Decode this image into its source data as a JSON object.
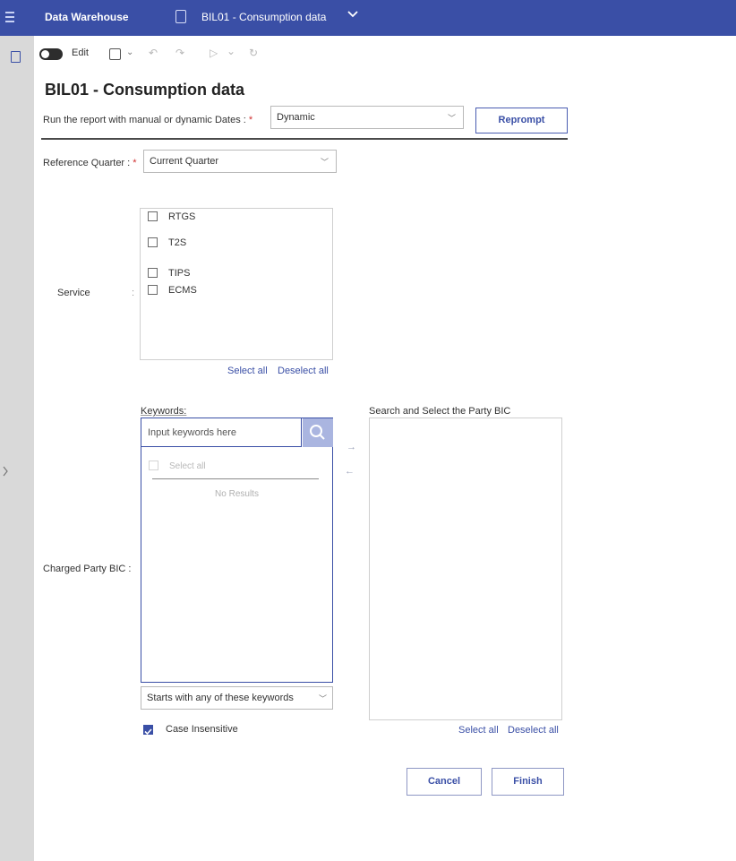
{
  "topbar": {
    "app_name": "Data Warehouse",
    "report_title": "BIL01 - Consumption data",
    "background": "#3a4fa6"
  },
  "toolbar": {
    "edit_label": "Edit",
    "undo": "↶",
    "redo": "↷",
    "run": "▷",
    "run_chevron": "⌄",
    "refresh": "↻"
  },
  "page": {
    "title": "BIL01 - Consumption data"
  },
  "dates_prompt": {
    "label": "Run the report with manual or dynamic Dates :",
    "required_mark": "*",
    "value": "Dynamic",
    "reprompt_label": "Reprompt"
  },
  "quarter_prompt": {
    "label": "Reference Quarter :",
    "required_mark": "*",
    "value": "Current Quarter"
  },
  "service": {
    "label": "Service",
    "colon": ":",
    "items": [
      {
        "label": "RTGS",
        "checked": false
      },
      {
        "label": "T2S",
        "checked": false
      },
      {
        "label": "TIPS",
        "checked": false
      },
      {
        "label": "ECMS",
        "checked": false
      }
    ],
    "select_all": "Select all",
    "deselect_all": "Deselect all"
  },
  "party_bic": {
    "label": "Charged Party BIC :",
    "keywords_label": "Keywords:",
    "keywords_placeholder": "Input keywords here",
    "results_select_all": "Select all",
    "no_results": "No Results",
    "add_arrow": "→",
    "remove_arrow": "←",
    "target_label": "Search and Select the Party BIC",
    "match_mode": "Starts with any of these keywords",
    "case_insensitive_label": "Case Insensitive",
    "case_insensitive_checked": true,
    "select_all": "Select all",
    "deselect_all": "Deselect all"
  },
  "footer": {
    "cancel_label": "Cancel",
    "finish_label": "Finish"
  },
  "icons": {
    "menu": "hamburger-menu-icon",
    "report": "report-icon",
    "save": "save-icon",
    "search": "search-icon"
  }
}
